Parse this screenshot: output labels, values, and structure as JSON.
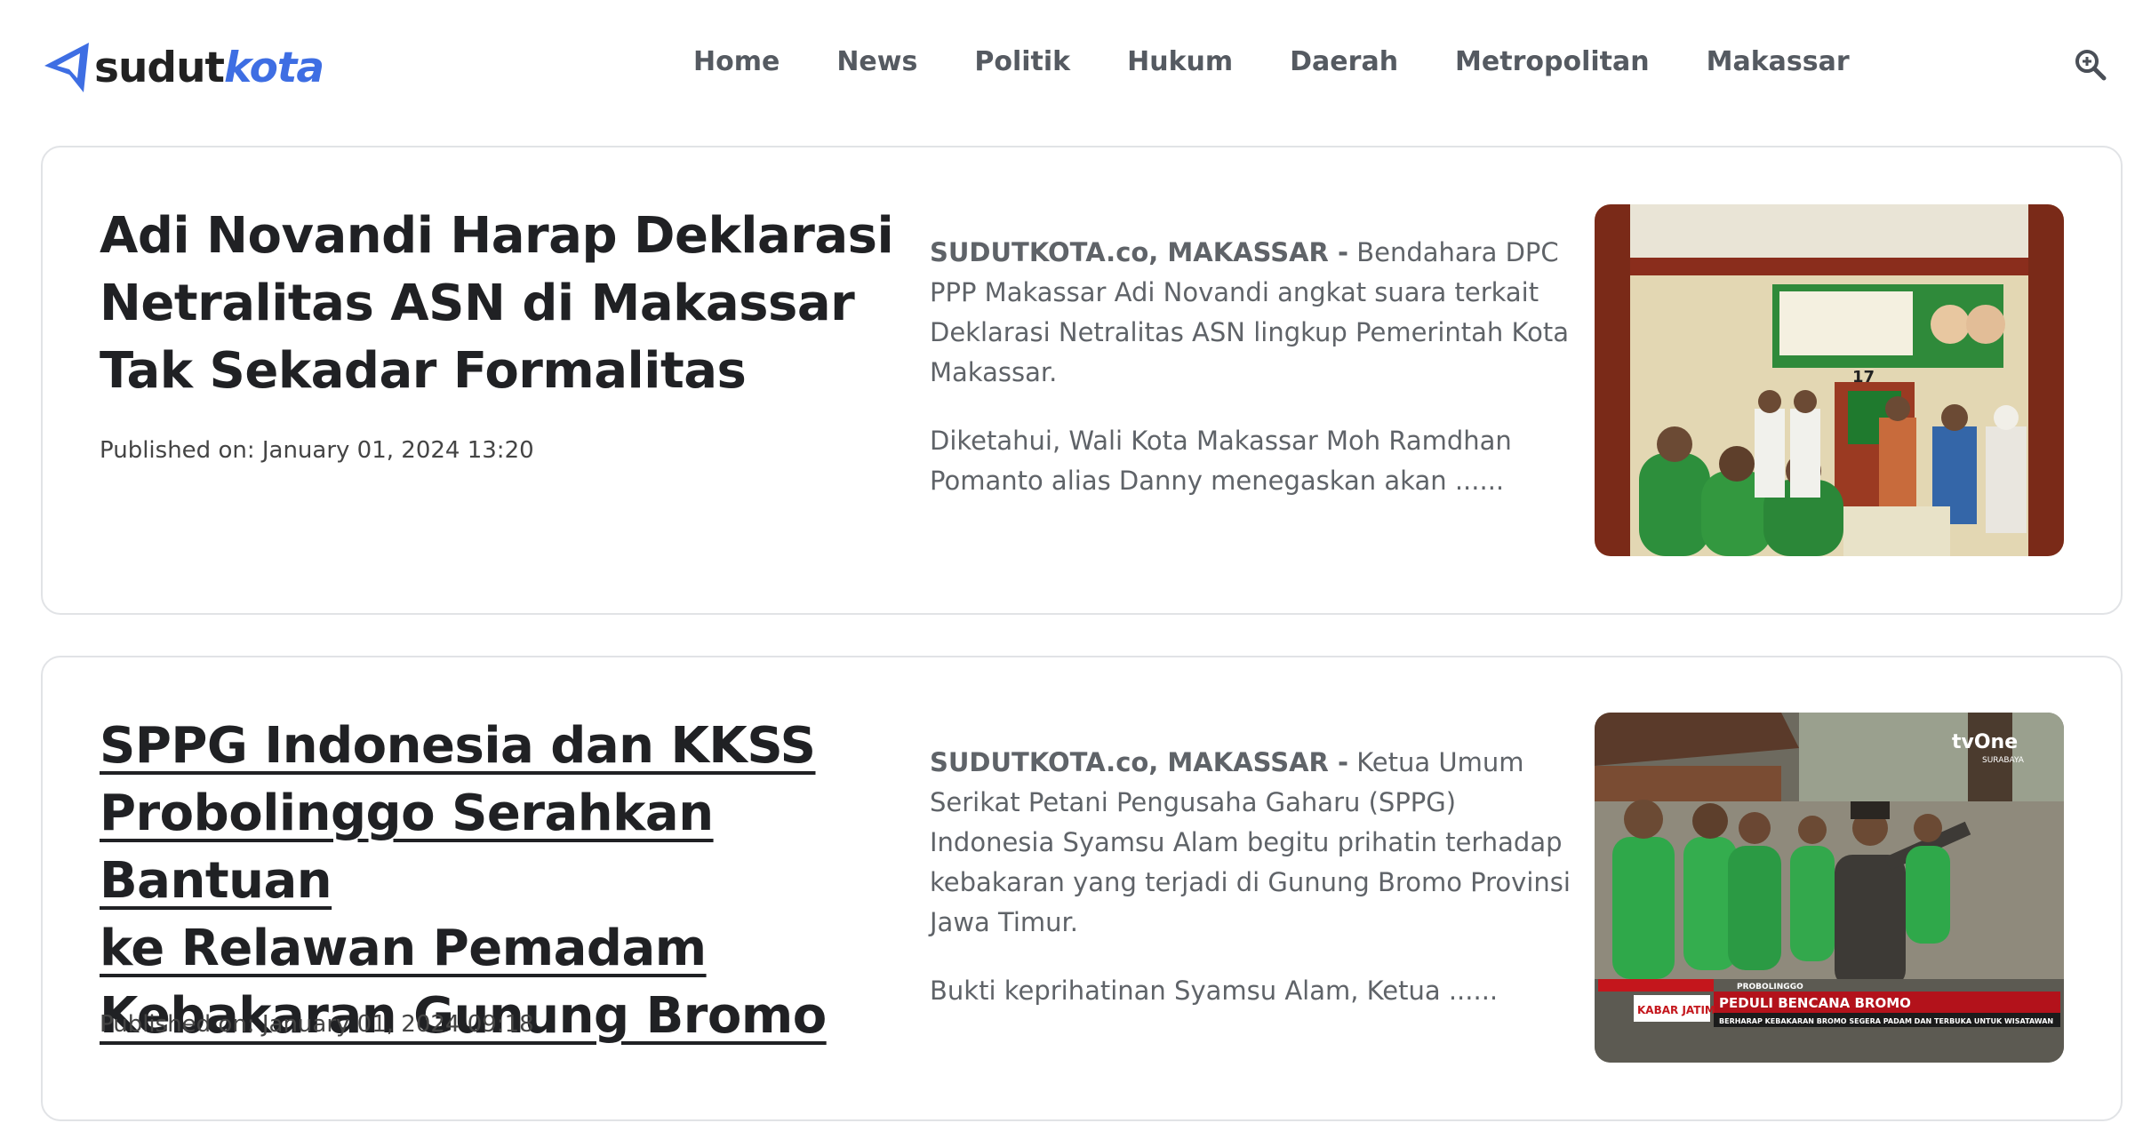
{
  "site": {
    "logo_part1": "sudut",
    "logo_part2": "kota"
  },
  "nav": {
    "items": [
      "Home",
      "News",
      "Politik",
      "Hukum",
      "Daerah",
      "Metropolitan",
      "Makassar"
    ],
    "search_icon": "search-icon"
  },
  "articles": [
    {
      "title": "Adi Novandi Harap Deklarasi Netralitas ASN di Makassar Tak Sekadar Formalitas",
      "published": "Published on: January 01, 2024 13:20",
      "dateline": "SUDUTKOTA.co, MAKASSAR -",
      "lead": " Bendahara DPC PPP Makassar Adi Novandi angkat suara terkait Deklarasi Netralitas ASN lingkup Pemerintah Kota Makassar.",
      "excerpt2": "Diketahui, Wali Kota Makassar Moh Ramdhan Pomanto alias Danny menegaskan akan ......",
      "image_number": "17"
    },
    {
      "title_lines": [
        "SPPG Indonesia dan KKSS",
        "Probolinggo Serahkan Bantuan",
        "ke Relawan Pemadam",
        "Kebakaran Gunung Bromo"
      ],
      "published": "Published on: January 01, 2024 09:18",
      "dateline": "SUDUTKOTA.co, MAKASSAR -",
      "lead": " Ketua Umum Serikat Petani Pengusaha Gaharu (SPPG) Indonesia Syamsu Alam begitu prihatin terhadap kebakaran yang terjadi di Gunung Bromo Provinsi Jawa Timur.",
      "excerpt2": "Bukti keprihatinan Syamsu Alam, Ketua ......",
      "image_text": {
        "channel": "tvOne",
        "channel_sub": "SURABAYA",
        "location": "PROBOLINGGO",
        "program": "KABAR JATIM",
        "headline": "PEDULI BENCANA BROMO",
        "subheadline": "BERHARAP KEBAKARAN BROMO SEGERA PADAM DAN TERBUKA UNTUK WISATAWAN"
      }
    }
  ]
}
